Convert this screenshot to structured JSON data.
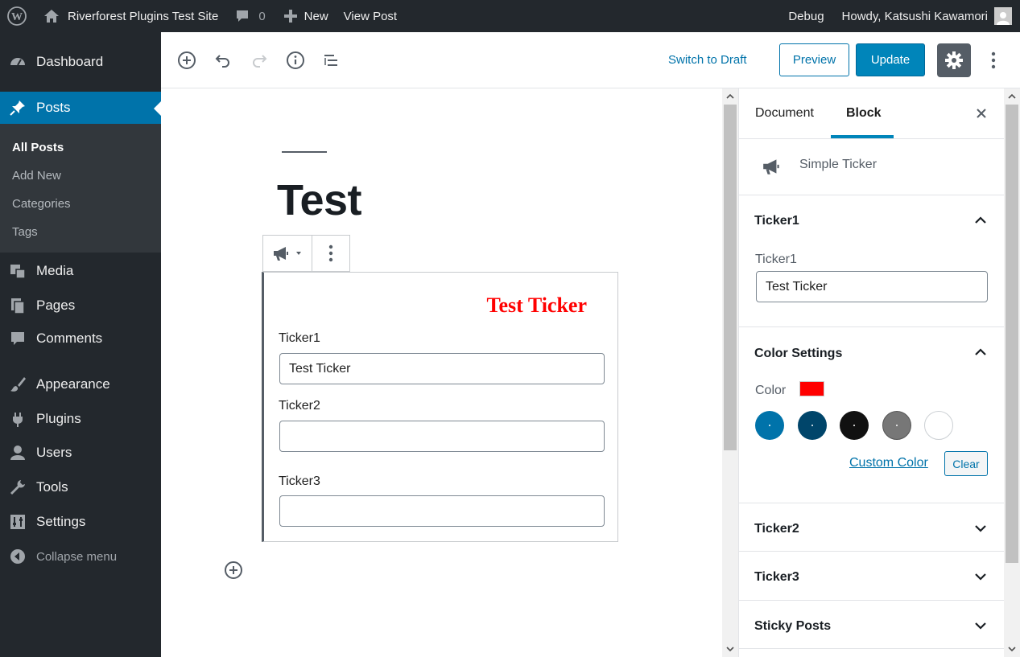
{
  "admin_bar": {
    "site_name": "Riverforest Plugins Test Site",
    "comments_count": "0",
    "new_label": "New",
    "view_post_label": "View Post",
    "debug_label": "Debug",
    "greeting": "Howdy, Katsushi Kawamori"
  },
  "sidebar": {
    "items": [
      {
        "label": "Dashboard",
        "icon": "dashboard-icon"
      },
      {
        "label": "Posts",
        "icon": "pin-icon"
      },
      {
        "label": "Media",
        "icon": "media-icon"
      },
      {
        "label": "Pages",
        "icon": "pages-icon"
      },
      {
        "label": "Comments",
        "icon": "comments-icon"
      },
      {
        "label": "Appearance",
        "icon": "brush-icon"
      },
      {
        "label": "Plugins",
        "icon": "plugin-icon"
      },
      {
        "label": "Users",
        "icon": "users-icon"
      },
      {
        "label": "Tools",
        "icon": "wrench-icon"
      },
      {
        "label": "Settings",
        "icon": "settings-icon"
      }
    ],
    "submenu": [
      "All Posts",
      "Add New",
      "Categories",
      "Tags"
    ],
    "collapse_label": "Collapse menu"
  },
  "toolbar": {
    "switch_to_draft": "Switch to Draft",
    "preview": "Preview",
    "update": "Update"
  },
  "post": {
    "title": "Test",
    "ticker_preview": "Test Ticker",
    "fields": [
      {
        "label": "Ticker1",
        "value": "Test Ticker"
      },
      {
        "label": "Ticker2",
        "value": ""
      },
      {
        "label": "Ticker3",
        "value": ""
      }
    ]
  },
  "settings_panel": {
    "tabs": [
      "Document",
      "Block"
    ],
    "active_tab": "Block",
    "block_name": "Simple Ticker",
    "sections": {
      "ticker1": {
        "title": "Ticker1",
        "field_label": "Ticker1",
        "value": "Test Ticker"
      },
      "color": {
        "title": "Color Settings",
        "label": "Color",
        "current": "#ff0000",
        "palette": [
          "#0073aa",
          "#00456a",
          "#111111",
          "#777777",
          "#ffffff"
        ],
        "custom_color": "Custom Color",
        "clear": "Clear"
      },
      "ticker2": {
        "title": "Ticker2"
      },
      "ticker3": {
        "title": "Ticker3"
      },
      "sticky": {
        "title": "Sticky Posts"
      }
    }
  },
  "colors": {
    "admin_bg": "#23282d",
    "accent": "#0073aa",
    "ticker_text": "#ff0000"
  }
}
